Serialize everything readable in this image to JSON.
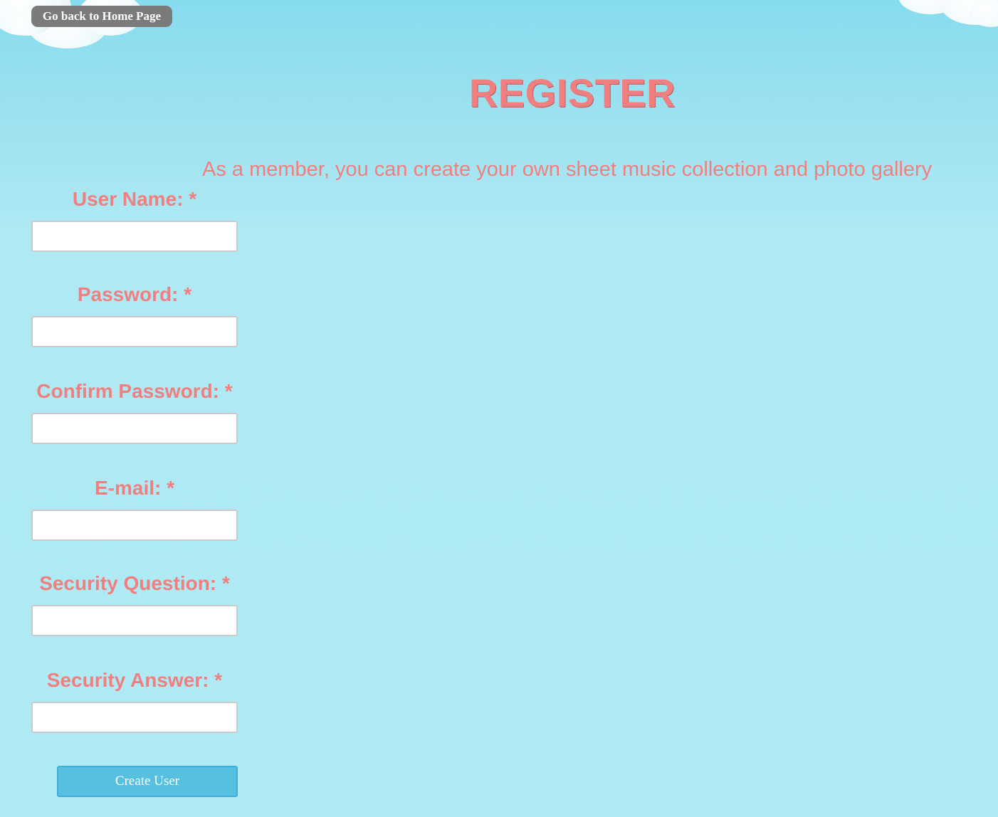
{
  "nav": {
    "home_label": "Go back to Home Page"
  },
  "header": {
    "title": "REGISTER",
    "tagline": "As a member, you can create your own sheet music collection and photo gallery"
  },
  "form": {
    "fields": [
      {
        "label": "User Name: *",
        "value": ""
      },
      {
        "label": "Password: *",
        "value": ""
      },
      {
        "label": "Confirm Password: *",
        "value": ""
      },
      {
        "label": "E-mail: *",
        "value": ""
      },
      {
        "label": "Security Question: *",
        "value": ""
      },
      {
        "label": "Security Answer: *",
        "value": ""
      }
    ],
    "submit_label": "Create User"
  },
  "colors": {
    "accent_text": "#f17f7f",
    "sky": "#afeaf5",
    "home_button_bg": "#7b7b7b",
    "submit_bg": "#57c0e1"
  },
  "icons": [
    "cloud-decoration"
  ]
}
